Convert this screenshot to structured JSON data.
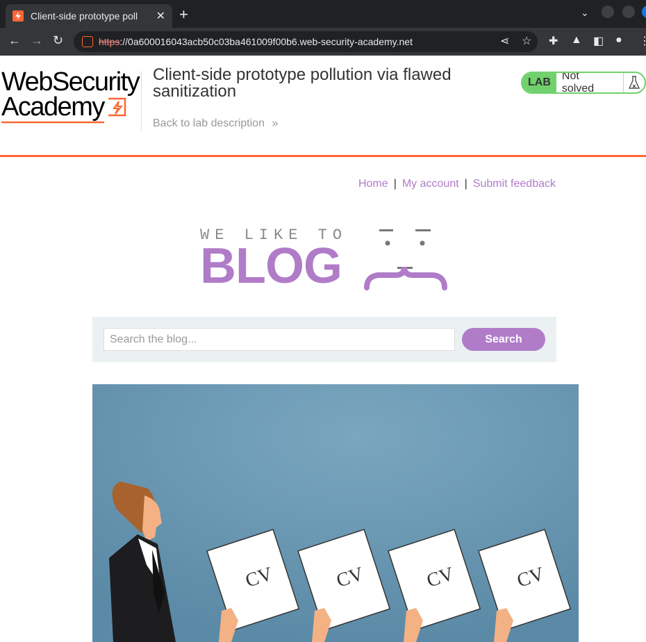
{
  "browser": {
    "tab_title": "Client-side prototype poll",
    "url_scheme": "https",
    "url_rest": "://0a600016043acb50c03ba461009f00b6.web-security-academy.net"
  },
  "lab": {
    "logo_line1": "WebSecurity",
    "logo_line2": "Academy",
    "title": "Client-side prototype pollution via flawed sanitization",
    "back_link": "Back to lab description",
    "badge_label": "LAB",
    "status": "Not solved"
  },
  "nav": {
    "home": "Home",
    "separator": "|",
    "my_account": "My account",
    "submit_feedback": "Submit feedback"
  },
  "blog_logo": {
    "tagline": "WE LIKE TO",
    "word": "BLOG"
  },
  "search": {
    "placeholder": "Search the blog...",
    "button": "Search"
  },
  "hero": {
    "cv_labels": [
      "CV",
      "CV",
      "CV",
      "CV"
    ]
  },
  "colors": {
    "brand_orange": "#ff6633",
    "blog_purple": "#b07cc8",
    "lab_green": "#70d16d"
  }
}
